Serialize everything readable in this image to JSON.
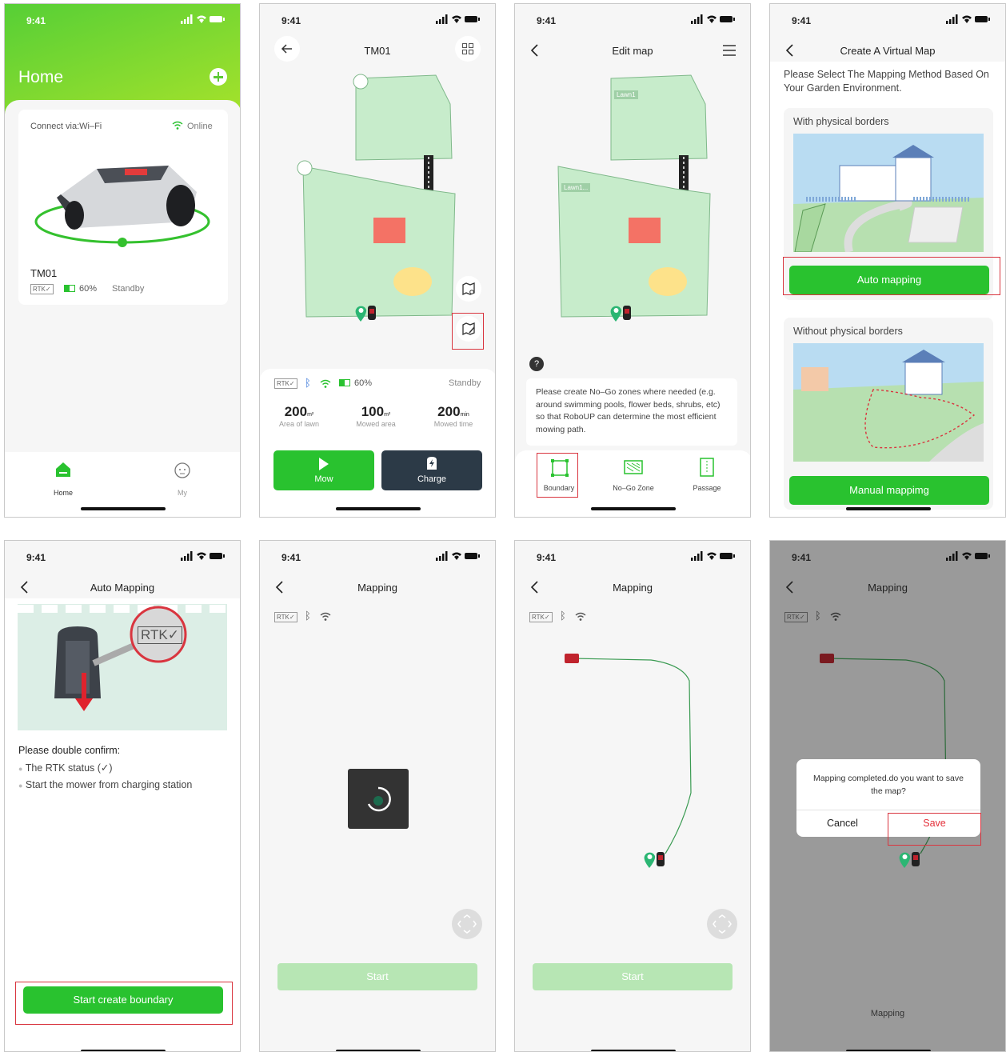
{
  "status_time": "9:41",
  "s1": {
    "title": "Home",
    "connect_label": "Connect via:Wi–Fi",
    "online_label": "Online",
    "device_name": "TM01",
    "rtk_label": "RTK✓",
    "battery_label": "60%",
    "state_label": "Standby",
    "tabs": [
      {
        "label": "Home",
        "icon": "home-icon"
      },
      {
        "label": "My",
        "icon": "robot-face-icon"
      }
    ]
  },
  "s2": {
    "title": "TM01",
    "rtk_label": "RTK✓",
    "battery_label": "60%",
    "state_label": "Standby",
    "stats": [
      {
        "value": "200",
        "unit": "m²",
        "label": "Area of lawn"
      },
      {
        "value": "100",
        "unit": "m²",
        "label": "Mowed area"
      },
      {
        "value": "200",
        "unit": "min",
        "label": "Mowed time"
      }
    ],
    "mow_label": "Mow",
    "charge_label": "Charge"
  },
  "s3": {
    "title": "Edit map",
    "lawn_a": "Lawn1",
    "lawn_b": "Lawn1...",
    "help_text": "Please create No–Go zones where needed (e.g. around swimming pools, flower beds, shrubs, etc) so that  RoboUP can determine the most efficient mowing path.",
    "tools": [
      {
        "label": "Boundary"
      },
      {
        "label": "No–Go Zone"
      },
      {
        "label": "Passage"
      }
    ]
  },
  "s4": {
    "title": "Create A Virtual Map",
    "subtitle": "Please Select The Mapping Method Based On Your Garden Environment.",
    "with_label": "With physical borders",
    "auto_label": "Auto mapping",
    "without_label": "Without physical borders",
    "manual_label": "Manual mappimg"
  },
  "s5": {
    "title": "Auto Mapping",
    "rtk_callout": "RTK✓",
    "confirm_title": "Please double confirm:",
    "items": [
      "The RTK status (✓)",
      "Start the mower from charging station"
    ],
    "start_label": "Start create boundary"
  },
  "s6": {
    "title": "Mapping",
    "rtk_label": "RTK✓",
    "start_label": "Start"
  },
  "s7": {
    "title": "Mapping",
    "rtk_label": "RTK✓",
    "start_label": "Start"
  },
  "s8": {
    "title": "Mapping",
    "rtk_label": "RTK✓",
    "dialog_text": "Mapping completed.do you want to save the map?",
    "cancel_label": "Cancel",
    "save_label": "Save",
    "footer_label": "Mapping"
  },
  "colors": {
    "brand_green": "#29c22f",
    "lawn": "#c7eccb",
    "nogo": "#f47265",
    "pool": "#fde28a",
    "highlight": "#d9353f"
  }
}
